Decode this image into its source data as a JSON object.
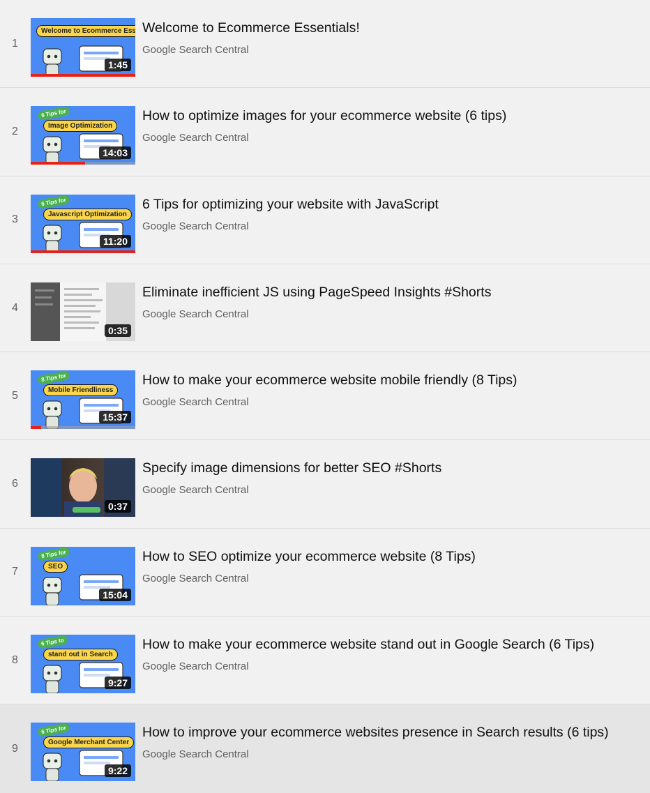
{
  "playlist": {
    "channel": "Google Search Central",
    "items": [
      {
        "index": "1",
        "title": "Welcome to Ecommerce Essentials!",
        "duration": "1:45",
        "progress": 1.0,
        "thumb_label": "Welcome to Ecommerce Essentials",
        "thumb_tag": ""
      },
      {
        "index": "2",
        "title": "How to optimize images for your ecommerce website (6 tips)",
        "duration": "14:03",
        "progress": 0.52,
        "thumb_label": "Image Optimization",
        "thumb_tag": "6 Tips for"
      },
      {
        "index": "3",
        "title": "6 Tips for optimizing your website with JavaScript",
        "duration": "11:20",
        "progress": 1.0,
        "thumb_label": "Javascript Optimization",
        "thumb_tag": "6 Tips for"
      },
      {
        "index": "4",
        "title": "Eliminate inefficient JS using PageSpeed Insights #Shorts",
        "duration": "0:35",
        "progress": 0,
        "thumb_label": "",
        "thumb_tag": ""
      },
      {
        "index": "5",
        "title": "How to make your ecommerce website mobile friendly (8 Tips)",
        "duration": "15:37",
        "progress": 0.1,
        "thumb_label": "Mobile Friendliness",
        "thumb_tag": "8 Tips for"
      },
      {
        "index": "6",
        "title": "Specify image dimensions for better SEO #Shorts",
        "duration": "0:37",
        "progress": 0,
        "thumb_label": "",
        "thumb_tag": ""
      },
      {
        "index": "7",
        "title": "How to SEO optimize your ecommerce website (8 Tips)",
        "duration": "15:04",
        "progress": 0,
        "thumb_label": "SEO",
        "thumb_tag": "8 Tips for"
      },
      {
        "index": "8",
        "title": "How to make your ecommerce website stand out in Google Search (6 Tips)",
        "duration": "9:27",
        "progress": 0,
        "thumb_label": "stand out in Search",
        "thumb_tag": "6 Tips to"
      },
      {
        "index": "9",
        "title": "How to improve your ecommerce websites presence in Search results (6 tips)",
        "duration": "9:22",
        "progress": 0,
        "thumb_label": "Google Merchant Center",
        "thumb_tag": "6 Tips for"
      }
    ]
  },
  "colors": {
    "background": "#f1f1f1",
    "highlight_row": "#e5e5e5",
    "thumb_blue": "#4a8af4",
    "thumb_yellow": "#fbd64a",
    "progress_red": "#e62117"
  }
}
